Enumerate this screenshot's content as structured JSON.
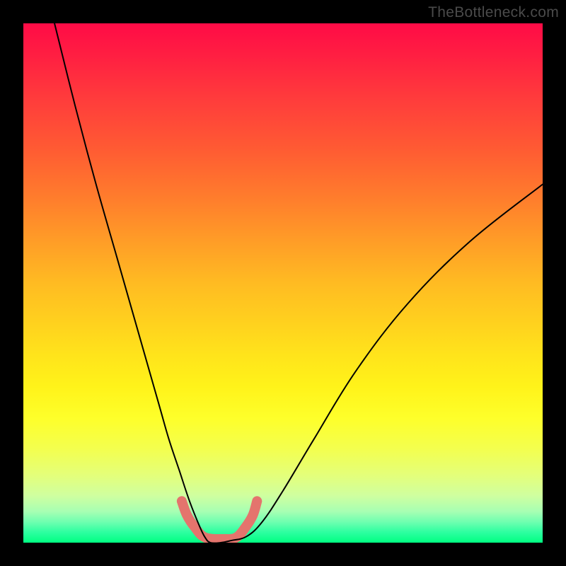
{
  "watermark": "TheBottleneck.com",
  "chart_data": {
    "type": "line",
    "title": "",
    "xlabel": "",
    "ylabel": "",
    "xlim": [
      0,
      100
    ],
    "ylim": [
      0,
      100
    ],
    "grid": false,
    "series": [
      {
        "name": "bottleneck-curve",
        "color": "#000000",
        "stroke_width": 2,
        "x": [
          6,
          10,
          14,
          18,
          22,
          26,
          28,
          30,
          32,
          34,
          35,
          36,
          38,
          40,
          43,
          46,
          50,
          56,
          64,
          74,
          86,
          100
        ],
        "y": [
          100,
          84,
          69,
          55,
          41,
          27,
          20,
          14,
          8,
          3,
          1,
          0,
          0,
          0.4,
          1.2,
          4,
          10,
          20,
          33,
          46,
          58,
          69
        ]
      },
      {
        "name": "bottom-marker-band",
        "color": "#e4746d",
        "stroke_width": 14,
        "linecap": "round",
        "x": [
          30.5,
          31.5,
          33.0,
          35.0,
          38.5,
          41.0,
          42.8,
          44.2,
          45.0
        ],
        "y": [
          8.0,
          5.3,
          3.0,
          1.0,
          0.7,
          1.0,
          3.0,
          5.3,
          8.0
        ]
      }
    ]
  }
}
